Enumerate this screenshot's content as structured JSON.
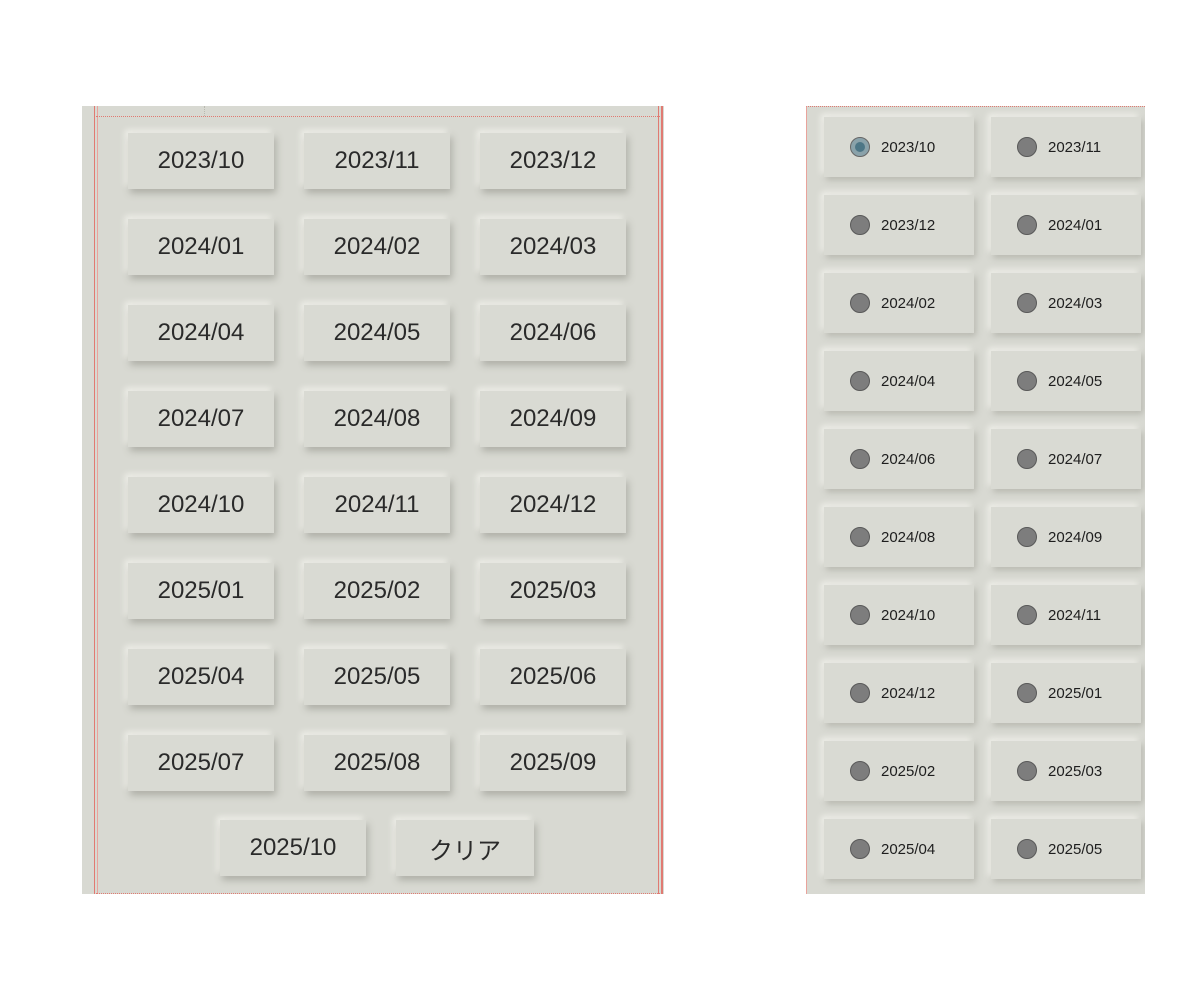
{
  "left_panel": {
    "month_buttons": [
      "2023/10",
      "2023/11",
      "2023/12",
      "2024/01",
      "2024/02",
      "2024/03",
      "2024/04",
      "2024/05",
      "2024/06",
      "2024/07",
      "2024/08",
      "2024/09",
      "2024/10",
      "2024/11",
      "2024/12",
      "2025/01",
      "2025/02",
      "2025/03",
      "2025/04",
      "2025/05",
      "2025/06",
      "2025/07",
      "2025/08",
      "2025/09"
    ],
    "last_month_button": "2025/10",
    "clear_label": "クリア"
  },
  "right_panel": {
    "selected": "2023/10",
    "radio_options": [
      "2023/10",
      "2023/11",
      "2023/12",
      "2024/01",
      "2024/02",
      "2024/03",
      "2024/04",
      "2024/05",
      "2024/06",
      "2024/07",
      "2024/08",
      "2024/09",
      "2024/10",
      "2024/11",
      "2024/12",
      "2025/01",
      "2025/02",
      "2025/03",
      "2025/04",
      "2025/05"
    ]
  },
  "colors": {
    "panel_bg": "#d8d9d2",
    "guide_line": "#e07a72",
    "radio_checked": "#4d7686"
  }
}
